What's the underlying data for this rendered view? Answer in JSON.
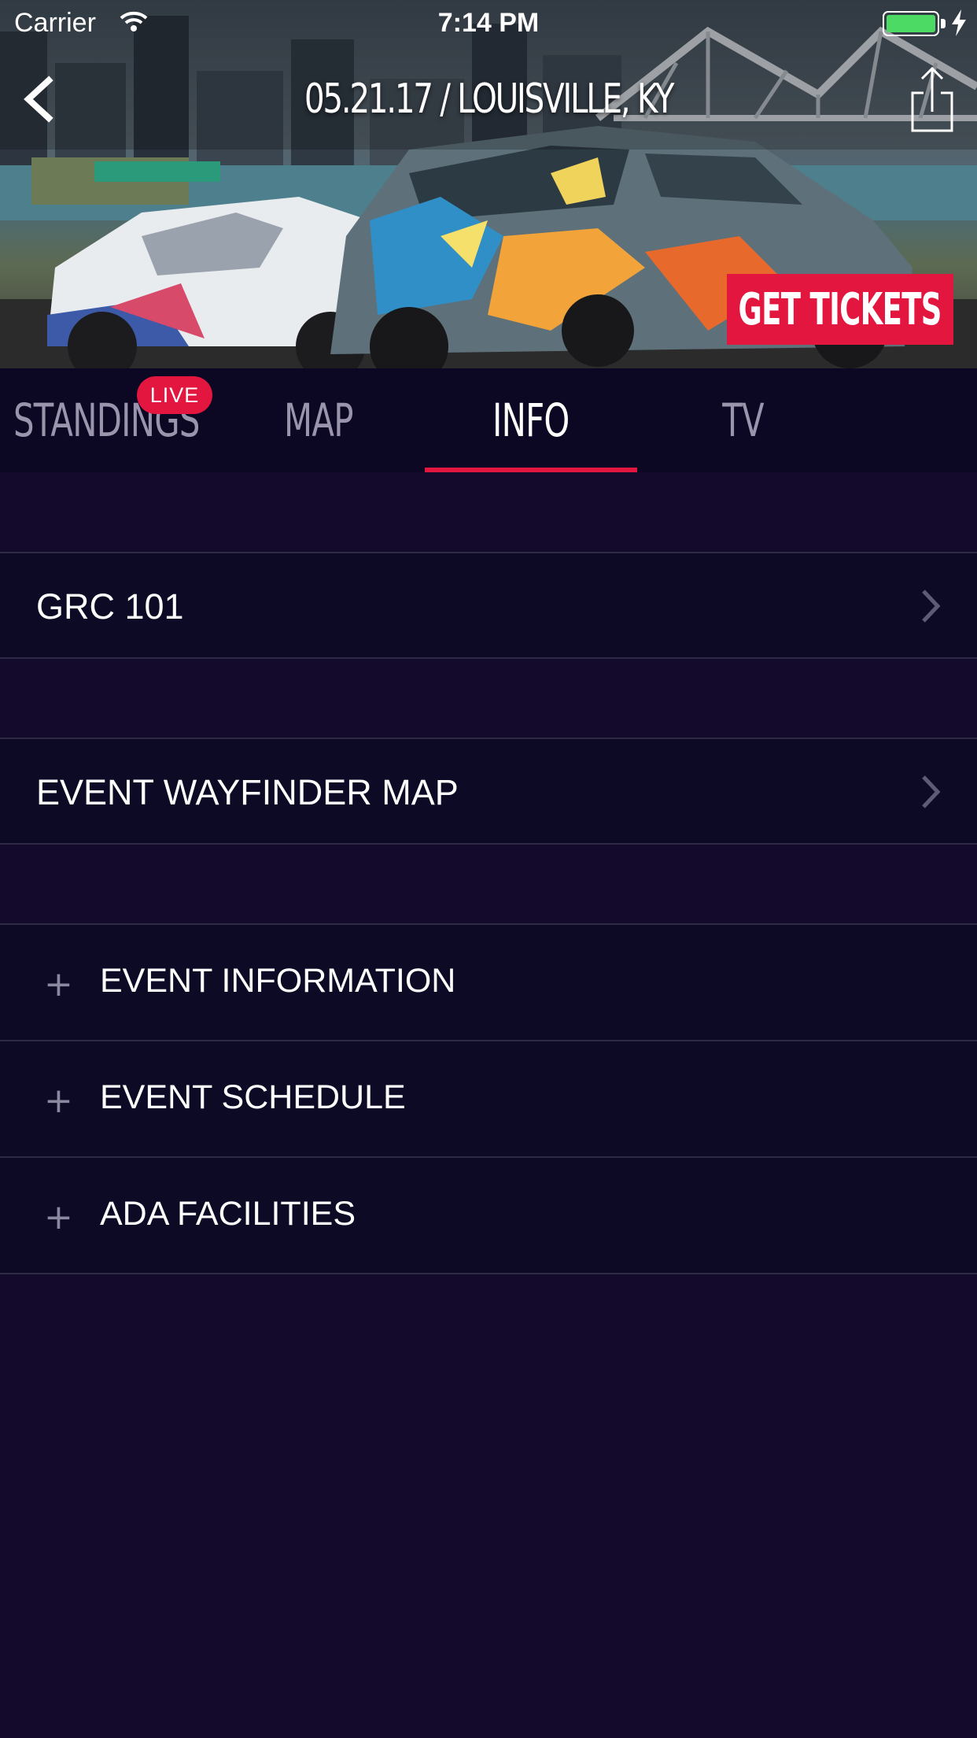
{
  "status_bar": {
    "carrier": "Carrier",
    "time": "7:14 PM",
    "battery_color": "#4cd964",
    "icons": [
      "wifi-icon",
      "battery-icon",
      "charging-bolt-icon"
    ]
  },
  "header": {
    "title": "05.21.17 / LOUISVILLE, KY",
    "back_icon": "chevron-left-icon",
    "share_icon": "share-icon",
    "tickets_label": "GET TICKETS"
  },
  "tabs": {
    "items": [
      {
        "label": "STANDINGS",
        "badge": "LIVE",
        "active": false
      },
      {
        "label": "MAP",
        "active": false
      },
      {
        "label": "INFO",
        "active": true
      },
      {
        "label": "TV",
        "active": false
      }
    ]
  },
  "links": [
    {
      "label": "GRC 101",
      "icon": "chevron-right-icon"
    },
    {
      "label": "EVENT WAYFINDER MAP",
      "icon": "chevron-right-icon"
    }
  ],
  "accordion": [
    {
      "label": "EVENT INFORMATION",
      "icon": "plus-icon"
    },
    {
      "label": "EVENT SCHEDULE",
      "icon": "plus-icon"
    },
    {
      "label": "ADA FACILITIES",
      "icon": "plus-icon"
    }
  ],
  "colors": {
    "accent": "#e3163f",
    "background": "#130a2c",
    "row_background": "#0c0a25",
    "tabbar_background": "#0c0824",
    "inactive_tab": "#9a95ad"
  }
}
